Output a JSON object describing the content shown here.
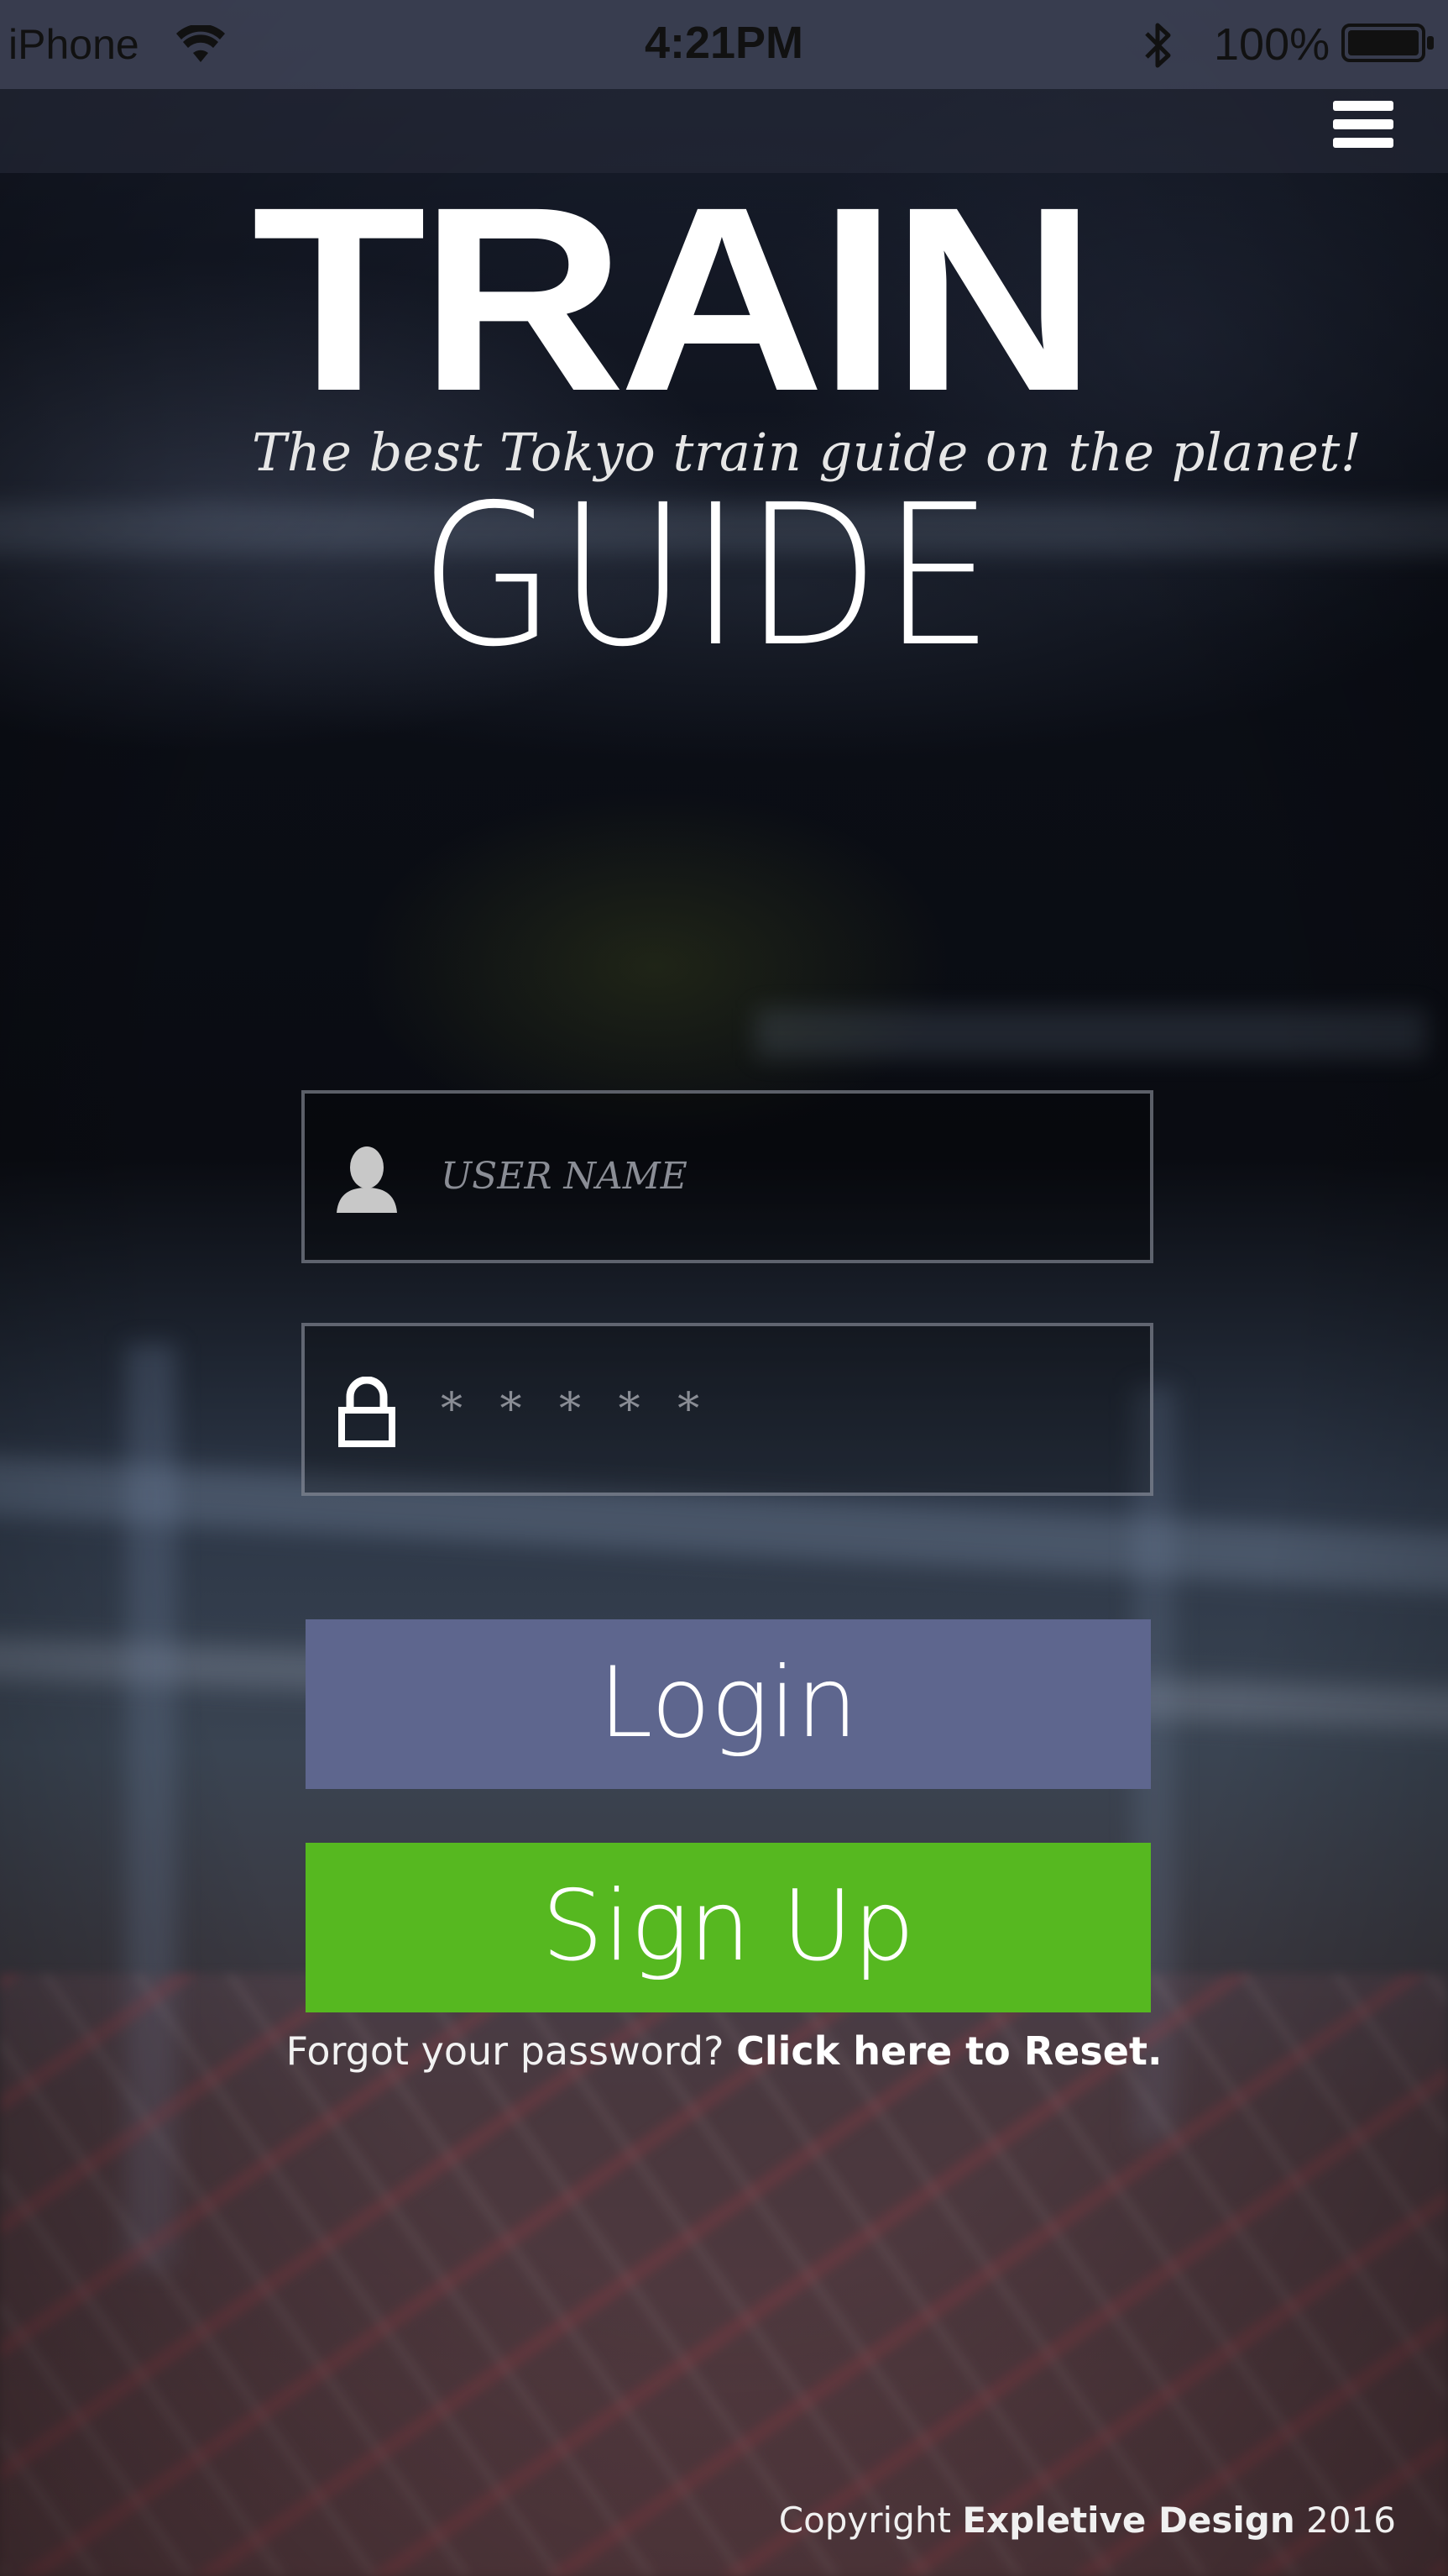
{
  "status_bar": {
    "carrier": "iPhone",
    "time": "4:21PM",
    "battery_percent": "100%"
  },
  "icons": {
    "menu": "hamburger-menu-icon",
    "username": "user-silhouette-icon",
    "password": "padlock-icon"
  },
  "logo": {
    "title_top": "TRAIN",
    "tagline": "The best Tokyo train guide on the planet!",
    "title_bottom": "GUIDE"
  },
  "login_form": {
    "username_placeholder": "USER NAME",
    "password_value": "* * * * *",
    "login_label": "Login",
    "signup_label": "Sign Up",
    "forgot_text": "Forgot your password?",
    "reset_link": "Click here to Reset."
  },
  "footer": {
    "copyright_prefix": "Copyright",
    "company": "Expletive Design",
    "year": "2016"
  },
  "colors": {
    "login_button": "#5e668e",
    "signup_button": "#56b820",
    "status_bar": "#3c4052"
  }
}
